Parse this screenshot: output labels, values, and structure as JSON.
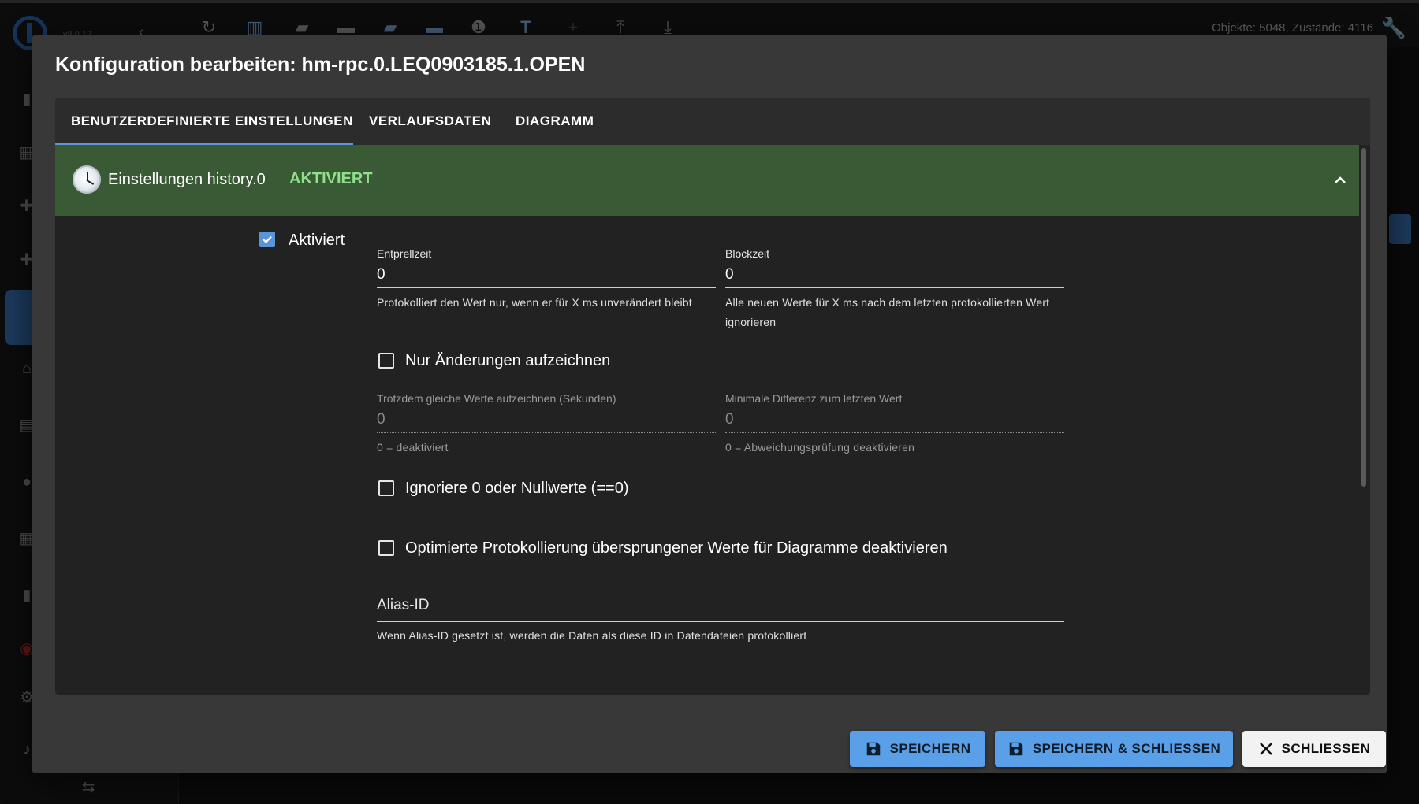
{
  "app": {
    "version": "v8.0.12",
    "objects_status": "Objekte: 5048, Zustände: 4116"
  },
  "toolbar": {
    "icons": [
      "refresh-icon",
      "columns-icon",
      "folder-open-icon",
      "folder-icon",
      "folder-open-icon",
      "folder-icon",
      "number-one-icon",
      "text-size-icon",
      "plus-icon",
      "upload-icon",
      "download-icon"
    ]
  },
  "dialog": {
    "title": "Konfiguration bearbeiten: hm-rpc.0.LEQ0903185.1.OPEN",
    "tabs": [
      {
        "label": "BENUTZERDEFINIERTE EINSTELLUNGEN",
        "active": true
      },
      {
        "label": "VERLAUFSDATEN",
        "active": false
      },
      {
        "label": "DIAGRAMM",
        "active": false
      }
    ],
    "panel": {
      "title": "Einstellungen history.0",
      "status": "AKTIVIERT",
      "status_color": "#8fe08a",
      "header_color": "#3a5a35"
    },
    "enabled": {
      "label": "Aktiviert",
      "checked": true
    },
    "debounce": {
      "label": "Entprellzeit",
      "value": "0",
      "helper": "Protokolliert den Wert nur, wenn er für X ms unverändert bleibt"
    },
    "block_time": {
      "label": "Blockzeit",
      "value": "0",
      "helper_line1": "Alle neuen Werte für X ms nach dem letzten protokollierten Wert",
      "helper_line2": "ignorieren"
    },
    "changes_only": {
      "label": "Nur Änderungen aufzeichnen",
      "checked": false
    },
    "same_values": {
      "label": "Trotzdem gleiche Werte aufzeichnen (Sekunden)",
      "value": "0",
      "helper": "0 = deaktiviert"
    },
    "min_diff": {
      "label": "Minimale Differenz zum letzten Wert",
      "value": "0",
      "helper": "0 = Abweichungsprüfung deaktivieren"
    },
    "ignore_zero": {
      "label": "Ignoriere 0 oder Nullwerte (==0)",
      "checked": false
    },
    "disable_skipped": {
      "label": "Optimierte Protokollierung übersprungener Werte für Diagramme deaktivieren",
      "checked": false
    },
    "alias": {
      "label": "Alias-ID",
      "value": "",
      "helper": "Wenn Alias-ID gesetzt ist, werden die Daten als diese ID in Datendateien protokolliert"
    },
    "buttons": {
      "save": "SPEICHERN",
      "save_close": "SPEICHERN & SCHLIESSEN",
      "close": "SCHLIESSEN"
    }
  }
}
